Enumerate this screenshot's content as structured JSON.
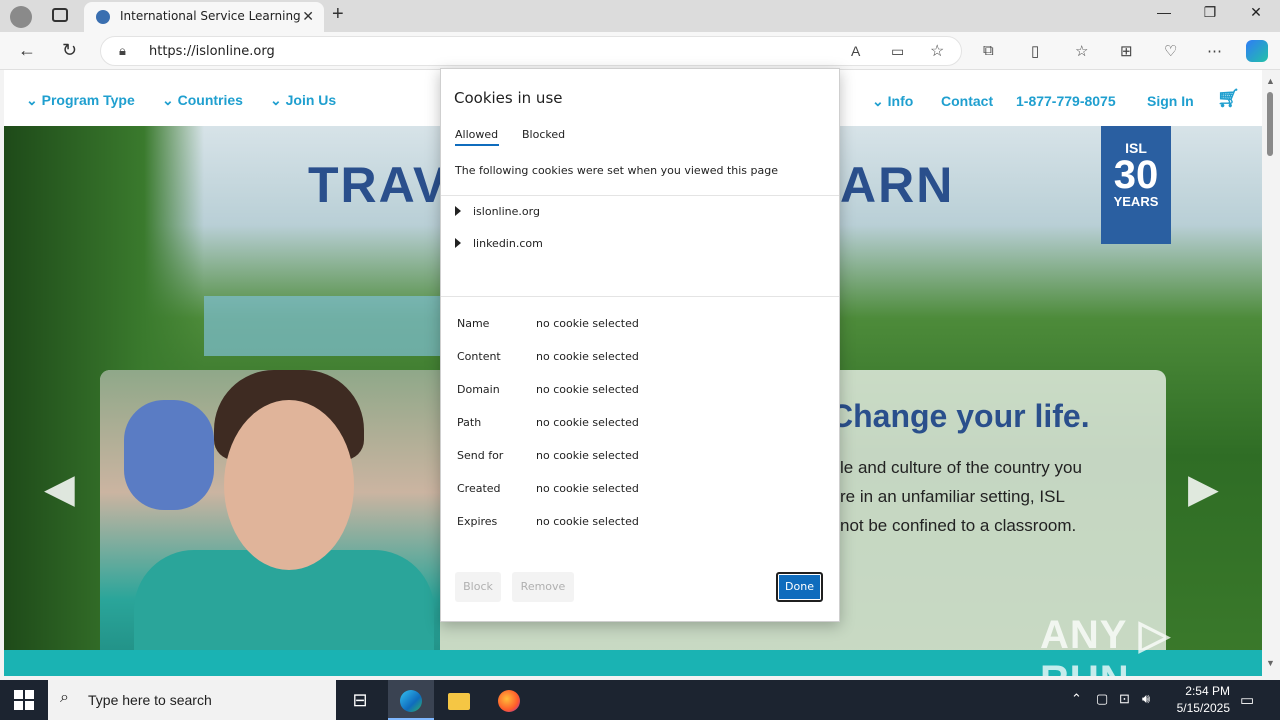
{
  "browser": {
    "tab_title": "International Service Learning",
    "url_prefix": "https://",
    "url_host": "islonline.org",
    "new_tab": "+",
    "tab_close": "✕",
    "minimize": "—",
    "restore": "❐",
    "close": "✕"
  },
  "site_nav": {
    "items": [
      "Program Type",
      "Countries",
      "Join Us",
      "Info",
      "Contact",
      "1-877-779-8075",
      "Sign In"
    ]
  },
  "hero": {
    "headline_left": "TRAV",
    "headline_right": "ARN",
    "badge_isl": "ISL",
    "badge_number": "30",
    "badge_years": "YEARS",
    "card_heading": "Change your life.",
    "card_lines": [
      "le and culture of the country you",
      "re in an unfamiliar setting, ISL",
      "not be confined to a classroom."
    ],
    "watermark": "ANY ▷ RUN"
  },
  "dialog": {
    "title": "Cookies in use",
    "tabs": [
      "Allowed",
      "Blocked"
    ],
    "description": "The following cookies were set when you viewed this page",
    "sites": [
      "islonline.org",
      "linkedin.com"
    ],
    "fields": [
      {
        "label": "Name",
        "value": "no cookie selected"
      },
      {
        "label": "Content",
        "value": "no cookie selected"
      },
      {
        "label": "Domain",
        "value": "no cookie selected"
      },
      {
        "label": "Path",
        "value": "no cookie selected"
      },
      {
        "label": "Send for",
        "value": "no cookie selected"
      },
      {
        "label": "Created",
        "value": "no cookie selected"
      },
      {
        "label": "Expires",
        "value": "no cookie selected"
      }
    ],
    "buttons": {
      "block": "Block",
      "remove": "Remove",
      "done": "Done"
    }
  },
  "taskbar": {
    "search_placeholder": "Type here to search",
    "time": "2:54 PM",
    "date": "5/15/2025"
  },
  "colors": {
    "accent": "#0f6cbd",
    "site_nav": "#1f9fcf",
    "headline": "#2a4f8c"
  }
}
